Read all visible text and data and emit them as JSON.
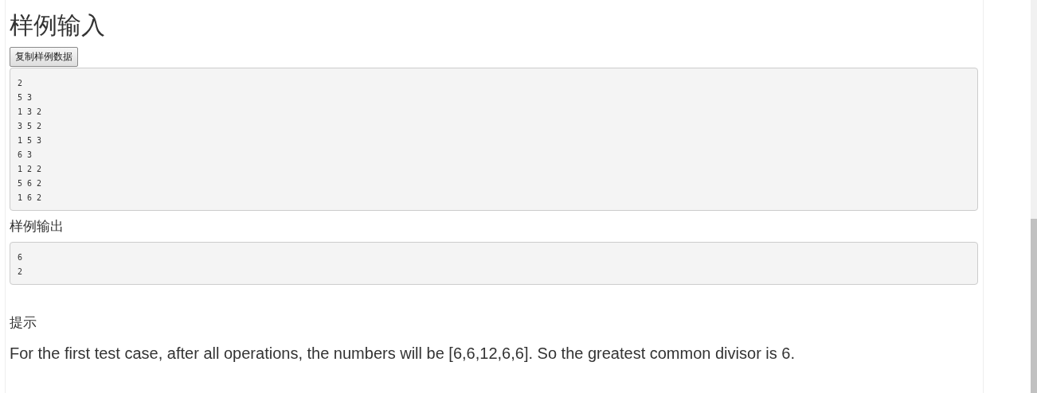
{
  "sample_input": {
    "heading": "样例输入",
    "copy_button": "复制样例数据",
    "text": "2\n5 3\n1 3 2\n3 5 2\n1 5 3\n6 3\n1 2 2\n5 6 2\n1 6 2"
  },
  "sample_output": {
    "heading": "样例输出",
    "text": "6\n2"
  },
  "hint": {
    "heading": "提示",
    "text": "For the first test case, after all operations, the numbers will be [6,6,12,6,6]. So the greatest common divisor is 6."
  }
}
